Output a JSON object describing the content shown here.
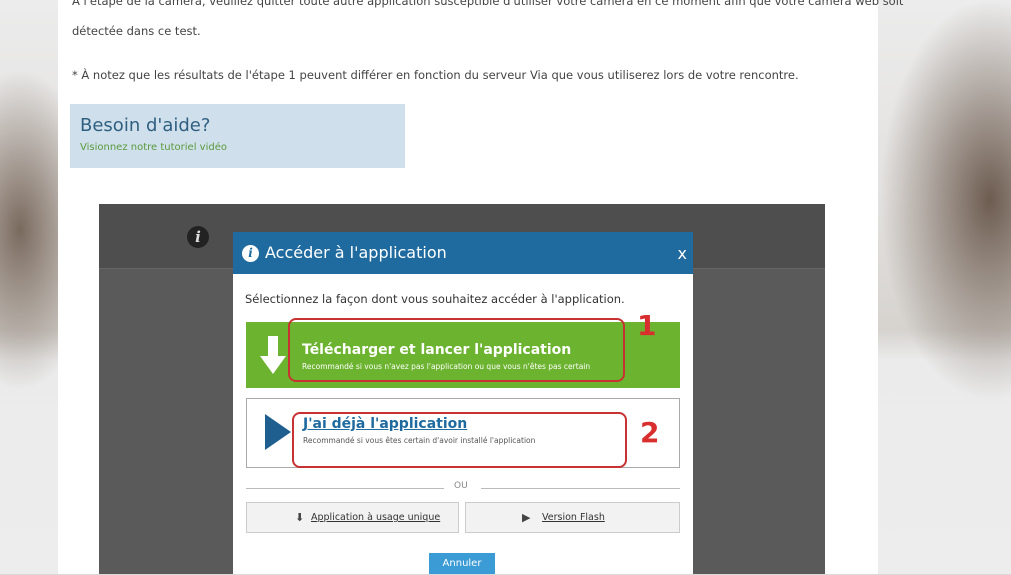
{
  "page": {
    "paragraph_1_line1": "À l'étape de la caméra, veuillez quitter toute autre application susceptible d'utiliser votre caméra en ce moment afin que votre caméra web soit",
    "paragraph_1_line2": "détectée dans ce test.",
    "paragraph_2": "* À notez que les résultats de l'étape 1 peuvent différer en fonction du serveur Via que vous utiliserez lors de votre rencontre."
  },
  "help": {
    "title": "Besoin d'aide?",
    "link": "Visionnez notre tutoriel vidéo"
  },
  "modal": {
    "icon": "info-icon",
    "title": "Accéder à l'application",
    "close": "x",
    "intro": "Sélectionnez la façon dont vous souhaitez accéder à l'application.",
    "option1": {
      "title": "Télécharger et lancer l'application",
      "subtitle": "Recommandé si vous n'avez pas l'application ou que vous n'êtes pas certain",
      "color": "#6cb32f"
    },
    "option2": {
      "title": "J'ai déjà l'application",
      "subtitle": "Recommandé si vous êtes certain d'avoir installé l'application"
    },
    "or": "OU",
    "single_use": "Application à usage unique",
    "flash": "Version Flash",
    "cancel": "Annuler"
  },
  "callouts": {
    "one": "1",
    "two": "2",
    "color": "#d92e2e"
  }
}
